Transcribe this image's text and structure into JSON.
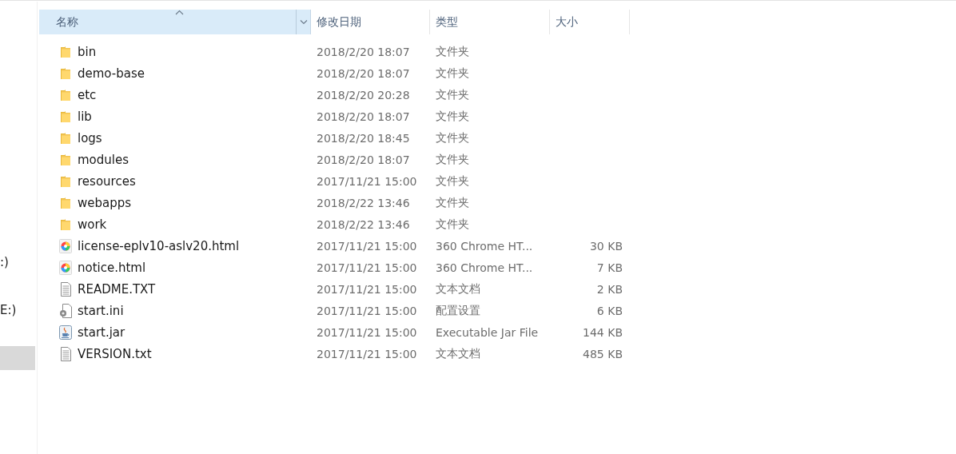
{
  "sidebar": {
    "items": [
      {
        "label": ":)",
        "selected": false
      },
      {
        "label": "E:)",
        "selected": false
      },
      {
        "selected": true
      }
    ]
  },
  "table": {
    "columns": [
      {
        "label": "名称",
        "sorted": true,
        "hover": true
      },
      {
        "label": "修改日期",
        "hover": false
      },
      {
        "label": "类型",
        "hover": false
      },
      {
        "label": "大小",
        "hover": false
      }
    ],
    "rows": [
      {
        "kind": "folder",
        "name": "bin",
        "modified": "2018/2/20 18:07",
        "type": "文件夹"
      },
      {
        "kind": "folder",
        "name": "demo-base",
        "modified": "2018/2/20 18:07",
        "type": "文件夹"
      },
      {
        "kind": "folder",
        "name": "etc",
        "modified": "2018/2/20 20:28",
        "type": "文件夹"
      },
      {
        "kind": "folder",
        "name": "lib",
        "modified": "2018/2/20 18:07",
        "type": "文件夹"
      },
      {
        "kind": "folder",
        "name": "logs",
        "modified": "2018/2/20 18:45",
        "type": "文件夹"
      },
      {
        "kind": "folder",
        "name": "modules",
        "modified": "2018/2/20 18:07",
        "type": "文件夹"
      },
      {
        "kind": "folder",
        "name": "resources",
        "modified": "2017/11/21 15:00",
        "type": "文件夹"
      },
      {
        "kind": "folder",
        "name": "webapps",
        "modified": "2018/2/22 13:46",
        "type": "文件夹"
      },
      {
        "kind": "folder",
        "name": "work",
        "modified": "2018/2/22 13:46",
        "type": "文件夹"
      },
      {
        "kind": "html",
        "name": "license-eplv10-aslv20.html",
        "modified": "2017/11/21 15:00",
        "type": "360 Chrome HT...",
        "size": "30 KB"
      },
      {
        "kind": "html",
        "name": "notice.html",
        "modified": "2017/11/21 15:00",
        "type": "360 Chrome HT...",
        "size": "7 KB"
      },
      {
        "kind": "text",
        "name": "README.TXT",
        "modified": "2017/11/21 15:00",
        "type": "文本文档",
        "size": "2 KB"
      },
      {
        "kind": "config",
        "name": "start.ini",
        "modified": "2017/11/21 15:00",
        "type": "配置设置",
        "size": "6 KB"
      },
      {
        "kind": "jar",
        "name": "start.jar",
        "modified": "2017/11/21 15:00",
        "type": "Executable Jar File",
        "size": "144 KB"
      },
      {
        "kind": "text",
        "name": "VERSION.txt",
        "modified": "2017/11/21 15:00",
        "type": "文本文档",
        "size": "485 KB"
      }
    ]
  }
}
